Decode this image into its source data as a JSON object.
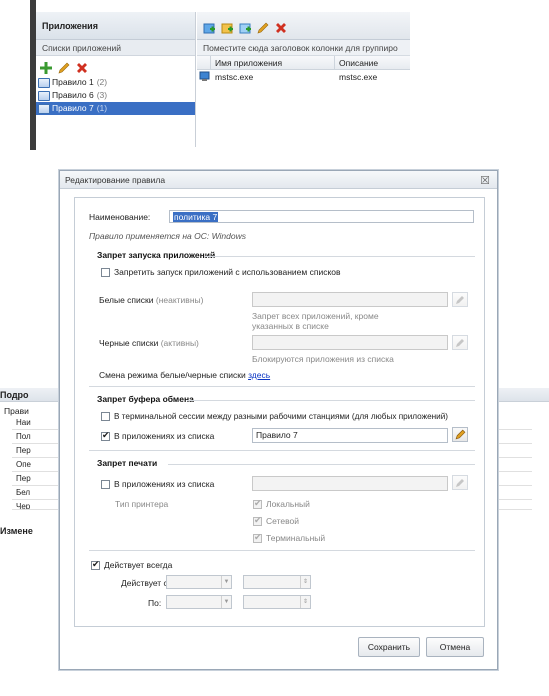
{
  "app": {
    "left": {
      "title": "Приложения",
      "subtitle": "Списки приложений",
      "rules": [
        {
          "name": "Правило 1",
          "count": "(2)"
        },
        {
          "name": "Правило 6",
          "count": "(3)"
        },
        {
          "name": "Правило 7",
          "count": "(1)"
        }
      ]
    },
    "right": {
      "group_hint": "Поместите сюда заголовок колонки для группиро",
      "columns": [
        "Имя приложения",
        "Описание"
      ],
      "rows": [
        {
          "name": "mstsc.exe",
          "desc": "mstsc.exe"
        }
      ]
    }
  },
  "details": {
    "title": "Подро",
    "tab": "Прави",
    "rows": [
      "Наи",
      "Пол",
      "Пер",
      "Опе",
      "Пер",
      "Бел",
      "Чер"
    ],
    "changes": "Измене"
  },
  "modal": {
    "title": "Редактирование правила",
    "close": "☒",
    "name_label": "Наименование:",
    "name_value": "политика 7",
    "os_note": "Правило применяется на ОС:  Windows",
    "launch": {
      "title": "Запрет запуска приложений",
      "cb_label": "Запретить запуск приложений с использованием списков",
      "white_label": "Белые списки",
      "white_state": "(неактивны)",
      "white_hint": "Запрет всех приложений, кроме указанных в списке",
      "black_label": "Черные списки",
      "black_state": "(активны)",
      "black_hint": "Блокируются приложения из списка",
      "switch_text": "Смена режима белые/черные списки",
      "switch_link": "здесь"
    },
    "clipboard": {
      "title": "Запрет буфера обмена",
      "cb1_label": "В терминальной сессии между разными рабочими станциями (для любых приложений)",
      "cb2_label": "В приложениях из списка",
      "cb2_value": "Правило 7"
    },
    "print": {
      "title": "Запрет печати",
      "cb_label": "В приложениях из списка",
      "printer_type_label": "Тип принтера",
      "types": [
        "Локальный",
        "Сетевой",
        "Терминальный"
      ]
    },
    "always": {
      "label": "Действует всегда",
      "from_label": "Действует с:",
      "to_label": "По:"
    },
    "buttons": {
      "save": "Сохранить",
      "cancel": "Отмена"
    }
  },
  "colors": {
    "selection": "#3a6fc4",
    "link": "#0a35c4",
    "delete": "#d03020",
    "add": "#3a9a30"
  }
}
